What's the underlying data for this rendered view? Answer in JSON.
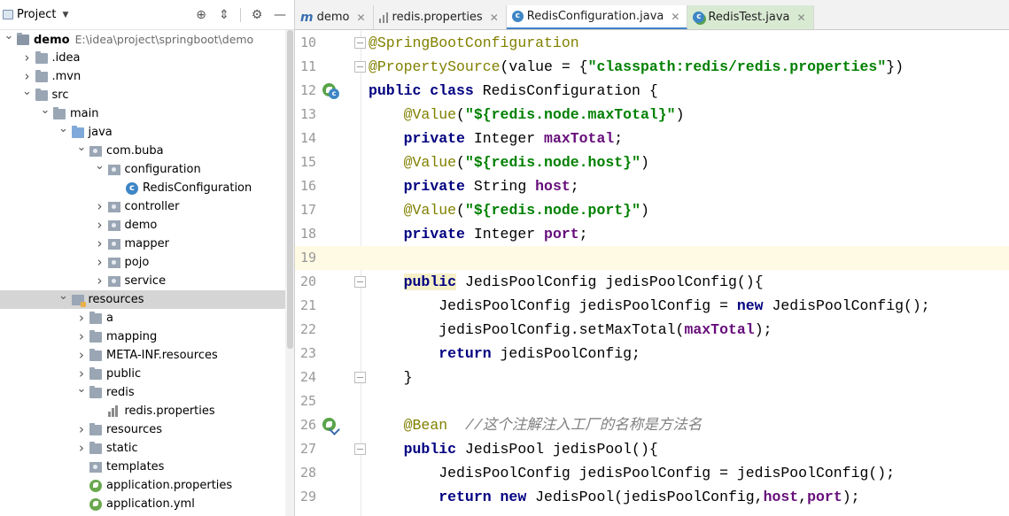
{
  "project_panel": {
    "title": "Project",
    "tree": [
      {
        "label": "demo",
        "path": "E:\\idea\\project\\springboot\\demo",
        "depth": 0,
        "expanded": true,
        "icon": "module-folder-icon",
        "bold": true
      },
      {
        "label": ".idea",
        "depth": 1,
        "expanded": false,
        "icon": "folder-icon"
      },
      {
        "label": ".mvn",
        "depth": 1,
        "expanded": false,
        "icon": "folder-icon"
      },
      {
        "label": "src",
        "depth": 1,
        "expanded": true,
        "icon": "folder-icon"
      },
      {
        "label": "main",
        "depth": 2,
        "expanded": true,
        "icon": "folder-icon"
      },
      {
        "label": "java",
        "depth": 3,
        "expanded": true,
        "icon": "source-folder-icon"
      },
      {
        "label": "com.buba",
        "depth": 4,
        "expanded": true,
        "icon": "package-icon"
      },
      {
        "label": "configuration",
        "depth": 5,
        "expanded": true,
        "icon": "package-icon"
      },
      {
        "label": "RedisConfiguration",
        "depth": 6,
        "icon": "class-icon"
      },
      {
        "label": "controller",
        "depth": 5,
        "expanded": false,
        "icon": "package-icon"
      },
      {
        "label": "demo",
        "depth": 5,
        "expanded": false,
        "icon": "package-icon"
      },
      {
        "label": "mapper",
        "depth": 5,
        "expanded": false,
        "icon": "package-icon"
      },
      {
        "label": "pojo",
        "depth": 5,
        "expanded": false,
        "icon": "package-icon"
      },
      {
        "label": "service",
        "depth": 5,
        "expanded": false,
        "icon": "package-icon"
      },
      {
        "label": "resources",
        "depth": 3,
        "expanded": true,
        "icon": "resources-folder-icon",
        "selected": true
      },
      {
        "label": "a",
        "depth": 4,
        "expanded": false,
        "icon": "folder-icon"
      },
      {
        "label": "mapping",
        "depth": 4,
        "expanded": false,
        "icon": "folder-icon"
      },
      {
        "label": "META-INF.resources",
        "depth": 4,
        "expanded": false,
        "icon": "folder-icon"
      },
      {
        "label": "public",
        "depth": 4,
        "expanded": false,
        "icon": "folder-icon"
      },
      {
        "label": "redis",
        "depth": 4,
        "expanded": true,
        "icon": "folder-icon"
      },
      {
        "label": "redis.properties",
        "depth": 5,
        "icon": "properties-file-icon"
      },
      {
        "label": "resources",
        "depth": 4,
        "expanded": false,
        "icon": "folder-icon"
      },
      {
        "label": "static",
        "depth": 4,
        "expanded": false,
        "icon": "folder-icon"
      },
      {
        "label": "templates",
        "depth": 4,
        "icon": "templates-folder-icon"
      },
      {
        "label": "application.properties",
        "depth": 4,
        "icon": "spring-config-icon"
      },
      {
        "label": "application.yml",
        "depth": 4,
        "icon": "spring-config-icon"
      }
    ]
  },
  "tabs": [
    {
      "label": "demo",
      "icon": "maven-module-icon"
    },
    {
      "label": "redis.properties",
      "icon": "properties-file-icon"
    },
    {
      "label": "RedisConfiguration.java",
      "icon": "class-icon",
      "active": true
    },
    {
      "label": "RedisTest.java",
      "icon": "test-class-icon"
    }
  ],
  "editor": {
    "lines": [
      {
        "num": "10",
        "tokens": [
          [
            "ann",
            "@SpringBootConfiguration"
          ]
        ],
        "fold": true
      },
      {
        "num": "11",
        "tokens": [
          [
            "ann",
            "@PropertySource"
          ],
          [
            "",
            "(value = {"
          ],
          [
            "str",
            "\"classpath:redis/redis.properties\""
          ],
          [
            "",
            "})"
          ]
        ],
        "fold": true
      },
      {
        "num": "12",
        "tokens": [
          [
            "kw",
            "public class "
          ],
          [
            "",
            "RedisConfiguration {"
          ]
        ],
        "gutter": "bean-class-icon"
      },
      {
        "num": "13",
        "tokens": [
          [
            "",
            "    "
          ],
          [
            "ann",
            "@Value"
          ],
          [
            "",
            "("
          ],
          [
            "str",
            "\"${redis.node.maxTotal}\""
          ],
          [
            "",
            ")"
          ]
        ]
      },
      {
        "num": "14",
        "tokens": [
          [
            "",
            "    "
          ],
          [
            "kw",
            "private "
          ],
          [
            "",
            "Integer "
          ],
          [
            "fld",
            "maxTotal"
          ],
          [
            "",
            ";"
          ]
        ]
      },
      {
        "num": "15",
        "tokens": [
          [
            "",
            "    "
          ],
          [
            "ann",
            "@Value"
          ],
          [
            "",
            "("
          ],
          [
            "str",
            "\"${redis.node.host}\""
          ],
          [
            "",
            ")"
          ]
        ]
      },
      {
        "num": "16",
        "tokens": [
          [
            "",
            "    "
          ],
          [
            "kw",
            "private "
          ],
          [
            "",
            "String "
          ],
          [
            "fld",
            "host"
          ],
          [
            "",
            ";"
          ]
        ]
      },
      {
        "num": "17",
        "tokens": [
          [
            "",
            "    "
          ],
          [
            "ann",
            "@Value"
          ],
          [
            "",
            "("
          ],
          [
            "str",
            "\"${redis.node.port}\""
          ],
          [
            "",
            ")"
          ]
        ]
      },
      {
        "num": "18",
        "tokens": [
          [
            "",
            "    "
          ],
          [
            "kw",
            "private "
          ],
          [
            "",
            "Integer "
          ],
          [
            "fld",
            "port"
          ],
          [
            "",
            ";"
          ]
        ]
      },
      {
        "num": "19",
        "tokens": [],
        "current": true
      },
      {
        "num": "20",
        "tokens": [
          [
            "",
            "    "
          ],
          [
            "kw hl",
            "public"
          ],
          [
            "",
            ""
          ],
          [
            "",
            "JedisPoolConfig jedisPoolConfig(){"
          ]
        ],
        "fold": true,
        "space_after_kw": true
      },
      {
        "num": "21",
        "tokens": [
          [
            "",
            "        JedisPoolConfig jedisPoolConfig = "
          ],
          [
            "kw",
            "new "
          ],
          [
            "",
            "JedisPoolConfig();"
          ]
        ]
      },
      {
        "num": "22",
        "tokens": [
          [
            "",
            "        jedisPoolConfig.setMaxTotal("
          ],
          [
            "fld",
            "maxTotal"
          ],
          [
            "",
            ");"
          ]
        ]
      },
      {
        "num": "23",
        "tokens": [
          [
            "",
            "        "
          ],
          [
            "kw",
            "return "
          ],
          [
            "",
            "jedisPoolConfig;"
          ]
        ]
      },
      {
        "num": "24",
        "tokens": [
          [
            "",
            "    }"
          ]
        ],
        "fold": true
      },
      {
        "num": "25",
        "tokens": []
      },
      {
        "num": "26",
        "tokens": [
          [
            "",
            "    "
          ],
          [
            "ann",
            "@Bean"
          ],
          [
            "",
            "  "
          ],
          [
            "cmt",
            "//这个注解注入工厂的名称是方法名"
          ]
        ],
        "gutter": "bean-navigate-icon"
      },
      {
        "num": "27",
        "tokens": [
          [
            "",
            "    "
          ],
          [
            "kw",
            "public "
          ],
          [
            "",
            "JedisPool jedisPool(){"
          ]
        ],
        "fold": true
      },
      {
        "num": "28",
        "tokens": [
          [
            "",
            "        JedisPoolConfig jedisPoolConfig = jedisPoolConfig();"
          ]
        ]
      },
      {
        "num": "29",
        "tokens": [
          [
            "",
            "        "
          ],
          [
            "kw",
            "return new "
          ],
          [
            "",
            "JedisPool(jedisPoolConfig,"
          ],
          [
            "fld",
            "host"
          ],
          [
            "",
            ","
          ],
          [
            "fld",
            "port"
          ],
          [
            "",
            ");"
          ]
        ]
      }
    ]
  },
  "colors": {
    "keyword": "#000080",
    "annotation": "#808000",
    "string": "#008000",
    "field": "#660e7a",
    "comment": "#808080",
    "selection": "#d5d5d5",
    "current_line": "#fffae3"
  }
}
